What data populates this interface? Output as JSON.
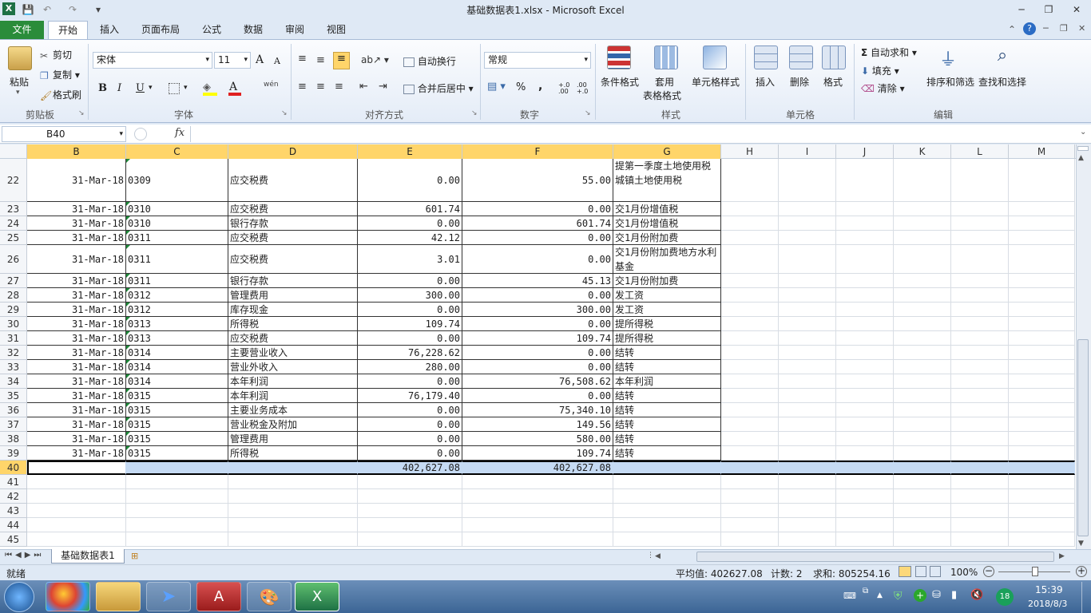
{
  "window": {
    "title": "基础数据表1.xlsx - Microsoft Excel",
    "min": "─",
    "max": "❐",
    "close": "✕"
  },
  "tabs": [
    "文件",
    "开始",
    "插入",
    "页面布局",
    "公式",
    "数据",
    "审阅",
    "视图"
  ],
  "ribbon": {
    "clipboard": {
      "paste": "粘贴",
      "cut": "剪切",
      "copy": "复制",
      "format_painter": "格式刷",
      "label": "剪贴板"
    },
    "font": {
      "name": "宋体",
      "size": "11",
      "bold": "B",
      "italic": "I",
      "underline": "U",
      "label": "字体",
      "grow": "A",
      "shrink": "A",
      "font_color": "A",
      "wen": "wén"
    },
    "align": {
      "wrap": "自动换行",
      "merge": "合并后居中",
      "label": "对齐方式"
    },
    "number": {
      "format": "常规",
      "percent": "%",
      "comma": ",",
      "inc": "+.0 .00",
      "dec": ".00 +.0",
      "label": "数字"
    },
    "styles": {
      "cond": "条件格式",
      "table1": "套用",
      "table2": "表格格式",
      "cell": "单元格样式",
      "label": "样式"
    },
    "cells": {
      "insert": "插入",
      "delete": "删除",
      "format": "格式",
      "label": "单元格"
    },
    "editing": {
      "autosum": "自动求和",
      "fill": "填充",
      "clear": "清除",
      "sort": "排序和筛选",
      "find": "查找和选择",
      "label": "编辑"
    }
  },
  "formula_bar": {
    "name_box": "B40",
    "fx": "fx",
    "value": ""
  },
  "columns": [
    "B",
    "C",
    "D",
    "E",
    "F",
    "G",
    "H",
    "I",
    "J",
    "K",
    "L",
    "M"
  ],
  "rows": [
    {
      "n": "22",
      "b": "31-Mar-18",
      "c": "0309",
      "d": "应交税费",
      "e": "0.00",
      "f": "55.00",
      "g": "提第一季度土地使用税城镇土地使用税"
    },
    {
      "n": "23",
      "b": "31-Mar-18",
      "c": "0310",
      "d": "应交税费",
      "e": "601.74",
      "f": "0.00",
      "g": "交1月份增值税"
    },
    {
      "n": "24",
      "b": "31-Mar-18",
      "c": "0310",
      "d": "银行存款",
      "e": "0.00",
      "f": "601.74",
      "g": "交1月份增值税"
    },
    {
      "n": "25",
      "b": "31-Mar-18",
      "c": "0311",
      "d": "应交税费",
      "e": "42.12",
      "f": "0.00",
      "g": "交1月份附加费"
    },
    {
      "n": "26",
      "b": "31-Mar-18",
      "c": "0311",
      "d": "应交税费",
      "e": "3.01",
      "f": "0.00",
      "g": "交1月份附加费地方水利基金"
    },
    {
      "n": "27",
      "b": "31-Mar-18",
      "c": "0311",
      "d": "银行存款",
      "e": "0.00",
      "f": "45.13",
      "g": "交1月份附加费"
    },
    {
      "n": "28",
      "b": "31-Mar-18",
      "c": "0312",
      "d": "管理费用",
      "e": "300.00",
      "f": "0.00",
      "g": "发工资"
    },
    {
      "n": "29",
      "b": "31-Mar-18",
      "c": "0312",
      "d": "库存现金",
      "e": "0.00",
      "f": "300.00",
      "g": "发工资"
    },
    {
      "n": "30",
      "b": "31-Mar-18",
      "c": "0313",
      "d": "所得税",
      "e": "109.74",
      "f": "0.00",
      "g": "提所得税"
    },
    {
      "n": "31",
      "b": "31-Mar-18",
      "c": "0313",
      "d": "应交税费",
      "e": "0.00",
      "f": "109.74",
      "g": "提所得税"
    },
    {
      "n": "32",
      "b": "31-Mar-18",
      "c": "0314",
      "d": "主要营业收入",
      "e": "76,228.62",
      "f": "0.00",
      "g": "结转"
    },
    {
      "n": "33",
      "b": "31-Mar-18",
      "c": "0314",
      "d": "营业外收入",
      "e": "280.00",
      "f": "0.00",
      "g": "结转"
    },
    {
      "n": "34",
      "b": "31-Mar-18",
      "c": "0314",
      "d": "本年利润",
      "e": "0.00",
      "f": "76,508.62",
      "g": "本年利润"
    },
    {
      "n": "35",
      "b": "31-Mar-18",
      "c": "0315",
      "d": "本年利润",
      "e": "76,179.40",
      "f": "0.00",
      "g": "结转"
    },
    {
      "n": "36",
      "b": "31-Mar-18",
      "c": "0315",
      "d": "主要业务成本",
      "e": "0.00",
      "f": "75,340.10",
      "g": "结转"
    },
    {
      "n": "37",
      "b": "31-Mar-18",
      "c": "0315",
      "d": "营业税金及附加",
      "e": "0.00",
      "f": "149.56",
      "g": "结转"
    },
    {
      "n": "38",
      "b": "31-Mar-18",
      "c": "0315",
      "d": "管理费用",
      "e": "0.00",
      "f": "580.00",
      "g": "结转"
    },
    {
      "n": "39",
      "b": "31-Mar-18",
      "c": "0315",
      "d": "所得税",
      "e": "0.00",
      "f": "109.74",
      "g": "结转"
    },
    {
      "n": "40",
      "b": "",
      "c": "",
      "d": "",
      "e": "402,627.08",
      "f": "402,627.08",
      "g": ""
    },
    {
      "n": "41"
    },
    {
      "n": "42"
    },
    {
      "n": "43"
    },
    {
      "n": "44"
    },
    {
      "n": "45"
    }
  ],
  "sheet_tab": "基础数据表1",
  "status": {
    "ready": "就绪",
    "avg": "平均值: 402627.08",
    "count": "计数: 2",
    "sum": "求和: 805254.16",
    "zoom": "100%"
  },
  "taskbar": {
    "time": "15:39",
    "date": "2018/8/3",
    "badge": "18"
  }
}
